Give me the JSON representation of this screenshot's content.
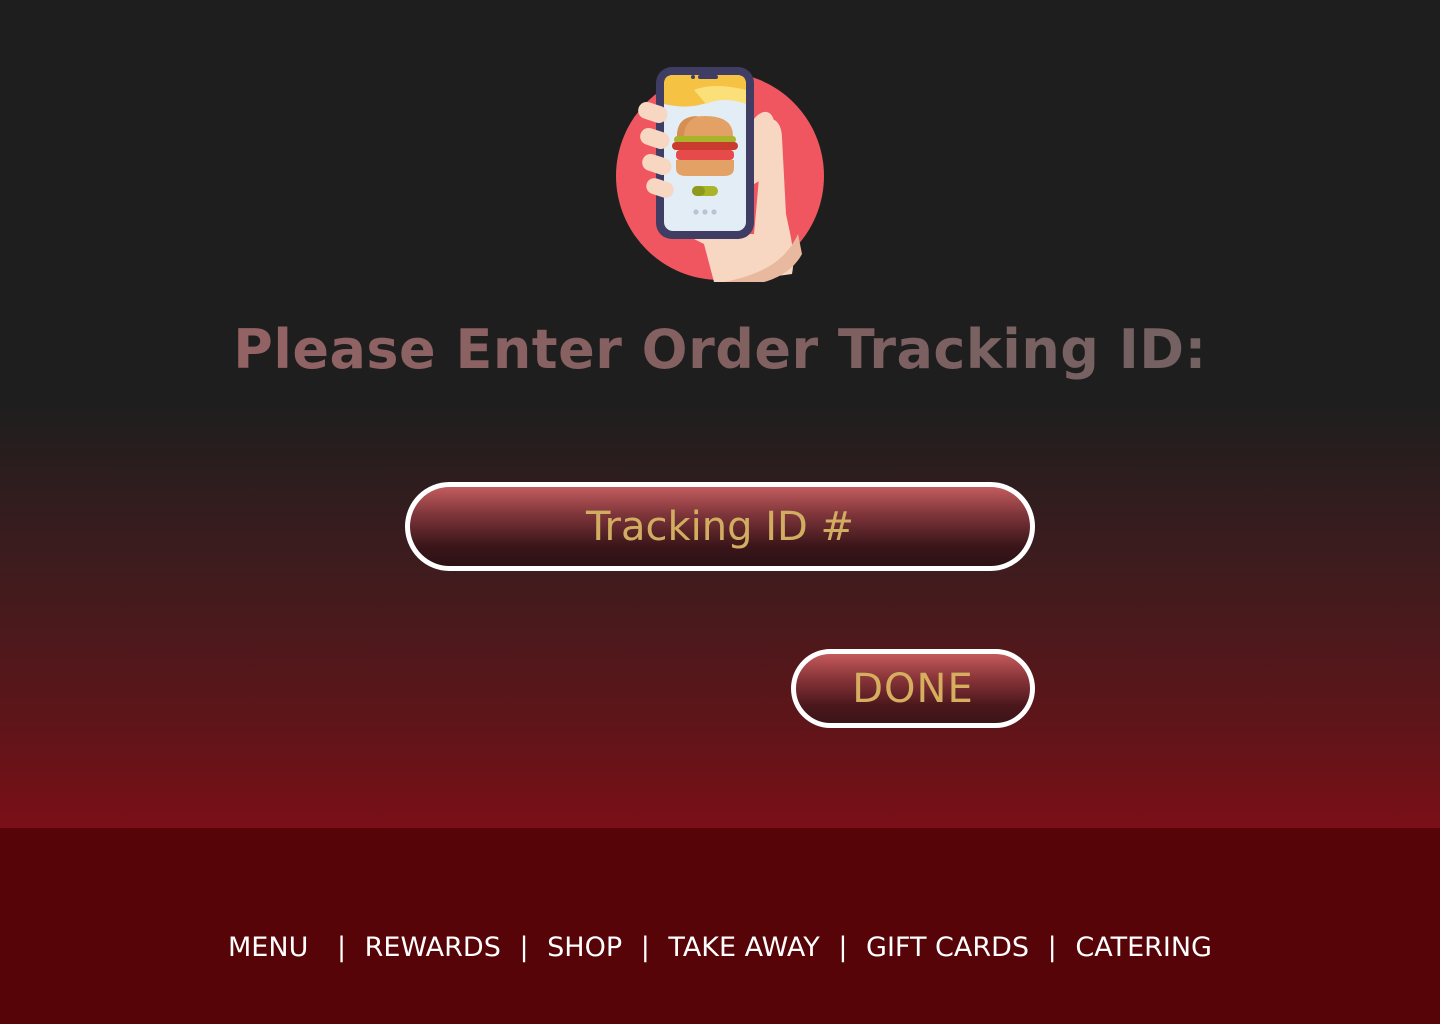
{
  "hero": {
    "icon": "phone-burger-order-icon",
    "colors": {
      "circle": "#f05660",
      "phone_frame": "#3f3d63",
      "screen": "#e3edf6",
      "hand": "#f8d7c2",
      "bun": "#e4a165",
      "lettuce": "#a9b42a",
      "patty": "#c93b2e"
    }
  },
  "headline": "Please Enter Order Tracking ID:",
  "tracking_input": {
    "placeholder": "Tracking ID #",
    "value": ""
  },
  "done_button": {
    "label": "DONE"
  },
  "footer": {
    "background": "#560408",
    "nav": [
      {
        "label": "MENU"
      },
      {
        "label": "REWARDS"
      },
      {
        "label": "SHOP"
      },
      {
        "label": "TAKE AWAY"
      },
      {
        "label": "GIFT CARDS"
      },
      {
        "label": "CATERING"
      }
    ],
    "separator": "|"
  }
}
